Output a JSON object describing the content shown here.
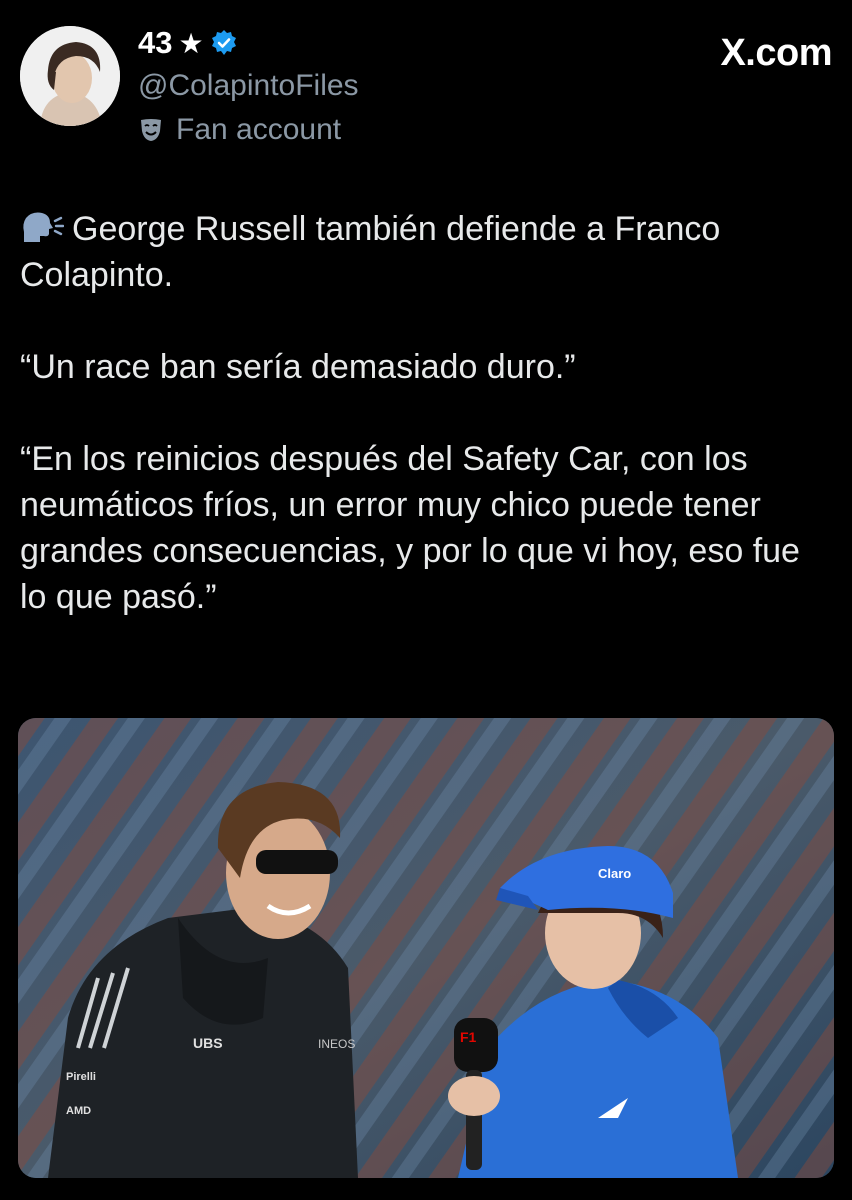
{
  "header": {
    "display_name": "43",
    "star_icon": "star-icon",
    "verified_icon": "verified-badge-icon",
    "handle": "@ColapintoFiles",
    "account_label": "Fan account",
    "account_label_icon": "theater-mask-icon",
    "site": "X.com"
  },
  "tweet": {
    "line1_icon": "speaking-head-icon",
    "line1_text": "George Russell también defiende a Franco Colapinto.",
    "quote1": "“Un race ban sería demasiado duro.”",
    "quote2": "“En los reinicios después del Safety Car, con los neumáticos fríos, un error muy chico puede tener grandes consecuencias, y por lo que vi hoy, eso fue lo que pasó.”"
  },
  "media": {
    "type": "photo",
    "mic_badge": "F1",
    "jacket_left_logos": [
      "UBS",
      "INEOS",
      "Pirelli",
      "AMD"
    ],
    "cap_logo": "Claro"
  },
  "colors": {
    "background": "#000000",
    "text": "#e7e9ea",
    "muted": "#8b98a5",
    "verified": "#1d9bf0",
    "alpine_blue": "#2a6fd6"
  }
}
